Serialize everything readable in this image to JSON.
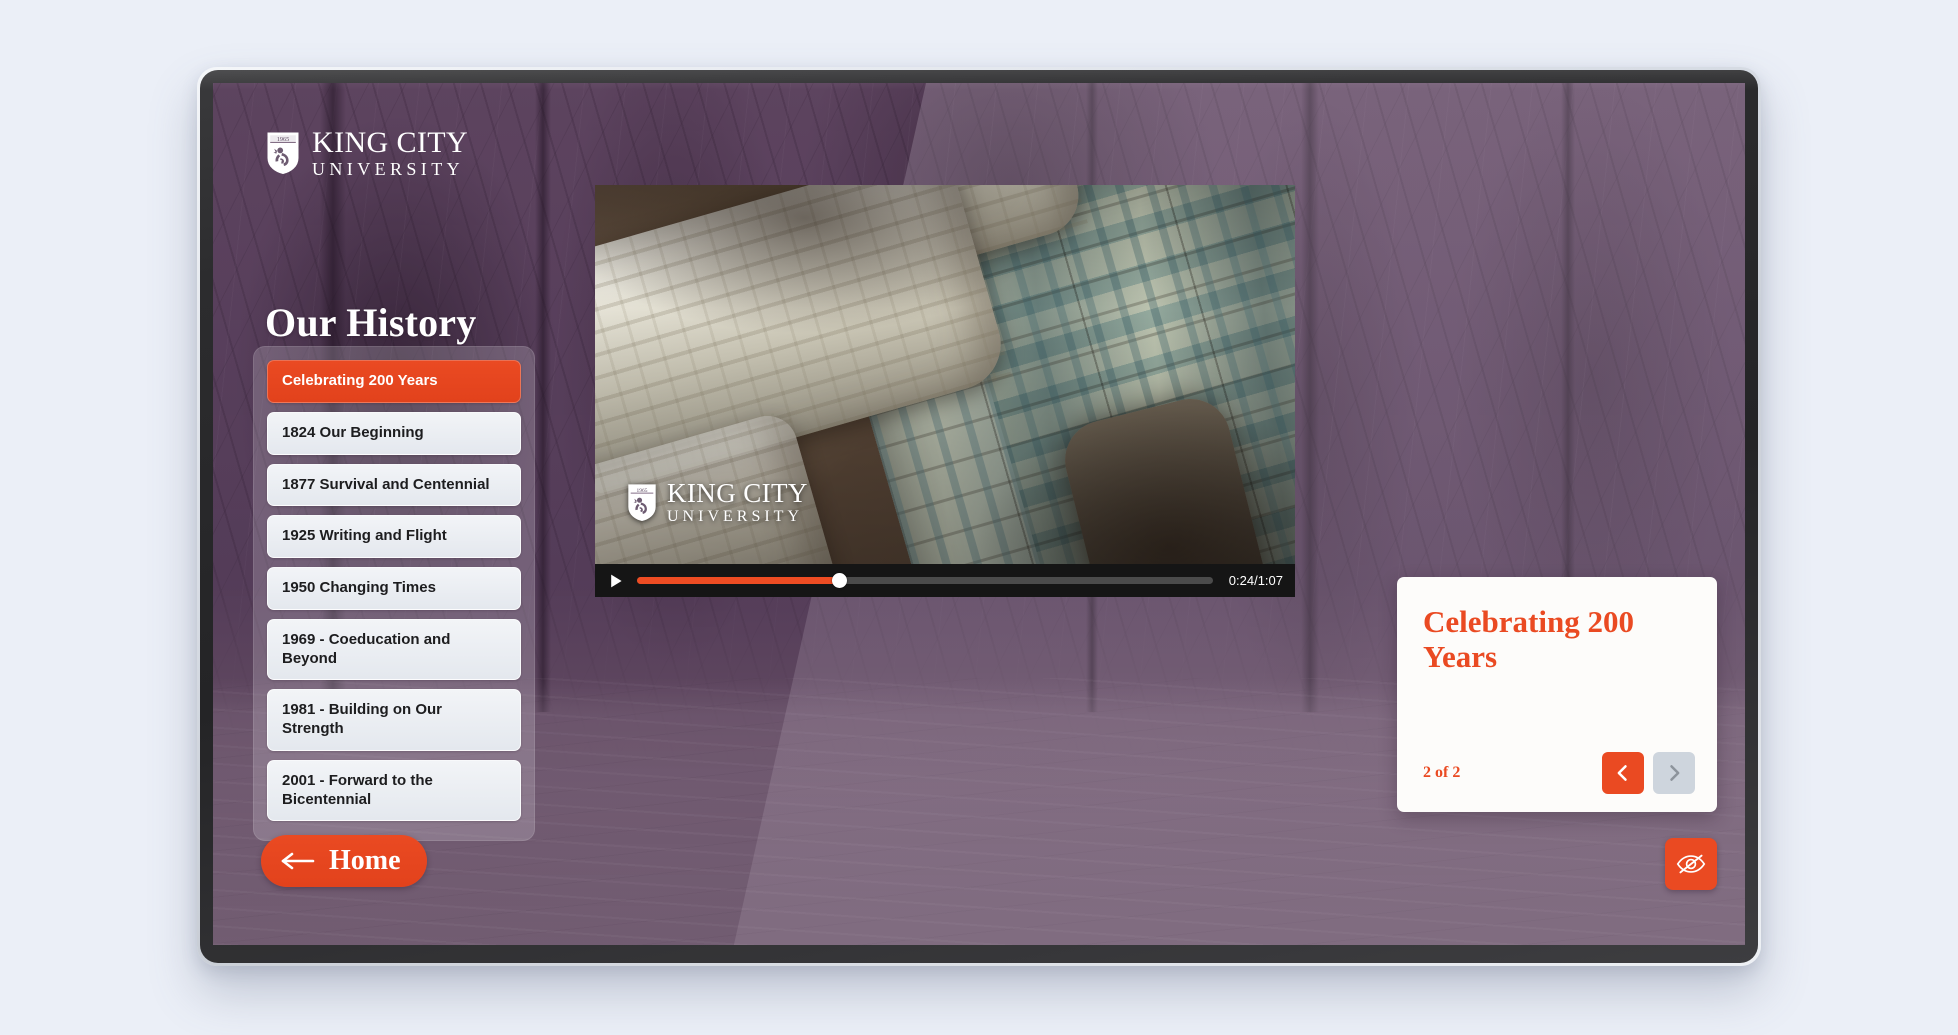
{
  "brand": {
    "shield_year": "1965",
    "name_line1": "King City",
    "name_line2": "University",
    "accent_color": "#ea4a22",
    "background_color": "#6e5570"
  },
  "page": {
    "title": "Our History"
  },
  "sidebar": {
    "items": [
      {
        "label": "Celebrating 200 Years",
        "active": true
      },
      {
        "label": "1824 Our Beginning",
        "active": false
      },
      {
        "label": "1877 Survival and Centennial",
        "active": false
      },
      {
        "label": "1925 Writing and Flight",
        "active": false
      },
      {
        "label": "1950 Changing Times",
        "active": false
      },
      {
        "label": "1969 - Coeducation and Beyond",
        "active": false
      },
      {
        "label": "1981 - Building on Our Strength",
        "active": false
      },
      {
        "label": "2001 - Forward to the Bicentennial",
        "active": false
      }
    ]
  },
  "home_button": {
    "label": "Home",
    "icon": "arrow-left-icon"
  },
  "video": {
    "watermark_line1": "King City",
    "watermark_line2": "University",
    "play_icon": "play-icon",
    "time_display": "0:24/1:07",
    "current_time": "0:24",
    "duration": "1:07",
    "progress_percent": 35
  },
  "info_card": {
    "heading": "Celebrating 200 Years",
    "page_counter": "2 of 2",
    "prev_icon": "chevron-left-icon",
    "next_icon": "chevron-right-icon",
    "prev_enabled": true,
    "next_enabled": false
  },
  "hide_button": {
    "icon": "eye-slash-icon"
  }
}
